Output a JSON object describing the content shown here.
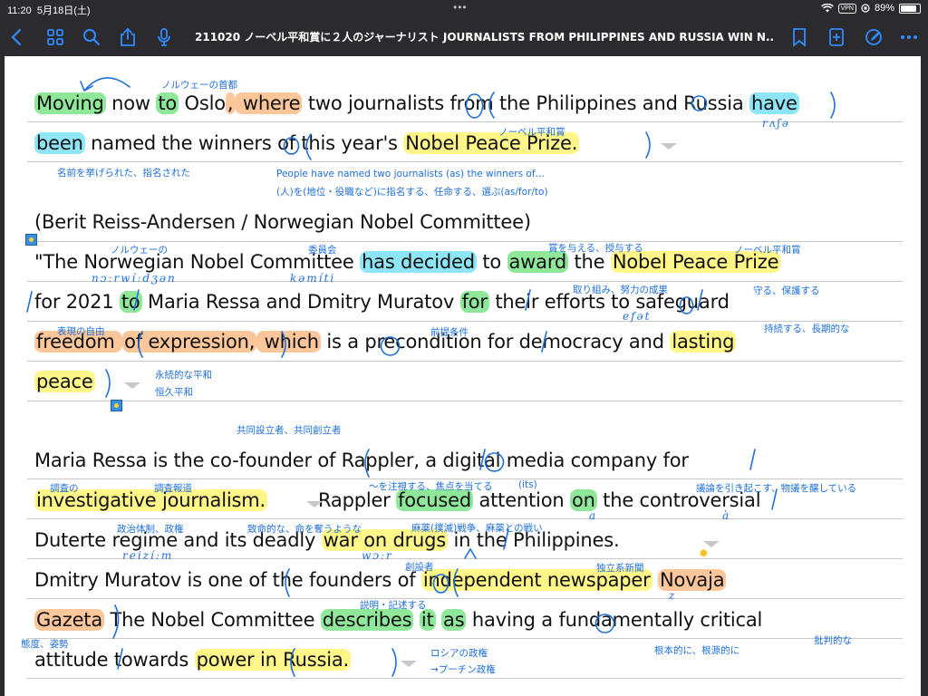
{
  "status": {
    "time": "11:20",
    "date": "5月18日(土)",
    "vpn": "VPN",
    "battery": "89%",
    "battery_level": 0.89
  },
  "toolbar": {
    "title": "211020 ノーベル平和賞に２人のジャーナリスト JOURNALISTS FROM PHILIPPINES AND RUSSIA WIN N...",
    "dropdown": "⌄"
  },
  "text": {
    "l1": {
      "a": "Moving",
      "b": " now ",
      "c": "to",
      "d": " Oslo",
      ",": ",",
      "e": " where",
      "f": " two journalist",
      "g": "s",
      "h": " from the Philippine",
      "i": "s",
      "j": " and Russia ",
      "k": "have"
    },
    "l2": {
      "a": "been",
      "b": " named the winner",
      "c": "s",
      "d": " of this year's ",
      "e": "Nobel Peace Prize."
    },
    "l3": "(Berit Reiss-Andersen / Norwegian Nobel Committee)",
    "l4": {
      "a": "\"The Norwegian Nobel Committee ",
      "b": "has decided",
      "c": " to ",
      "d": "award",
      "e": " the ",
      "f": "Nobel Peace Prize"
    },
    "l5": {
      "a": "for 2021 ",
      "b": "to",
      "c": " Maria Ressa and Dmitry Muratov ",
      "d": "for",
      "e": " their effort",
      "f": "s",
      "g": " to safeguard"
    },
    "l6": {
      "a": "freedom ",
      "b": "of expression,",
      "c": " which",
      "d": " is ",
      "e": "a",
      "f": " precondition for democracy and ",
      "g": "lasting"
    },
    "l7": {
      "a": "peace",
      ".": ".\""
    },
    "l8": {
      "a": "Maria Ressa is the co-founder of Rappler, ",
      "b": "a",
      "c": " digital media company for"
    },
    "l9": {
      "a": "investigative journalism.",
      "b": "Rappler ",
      "c": "focused",
      "d": " attention ",
      "e": "on",
      "f": " the controversial"
    },
    "l10": {
      "a": "Duterte regime and its deadly ",
      "b": "war on drugs",
      "c": " in the Philippines."
    },
    "l11": {
      "a": "Dmitry Muratov is one of the founder",
      "b": "s",
      "c": " of ",
      "d": "independent newspaper",
      "e": " ",
      "f": "Novaja"
    },
    "l12": {
      "a": "Gazeta",
      ".": ".",
      "b": " The Nobel Committee ",
      "c": "describes",
      "d": " ",
      "e": "it",
      "f": " ",
      "g": "as",
      "h": " having ",
      "i": "a",
      "j": " fundamentally critical"
    },
    "l13": {
      "a": "attitude towards ",
      "b": "power in Russia."
    }
  },
  "notes": {
    "n1": "ノルウェーの首都",
    "n2": "ノーベル平和賞",
    "n3": "名前を挙げられた、指名された",
    "n4": "People have named two journalists (as) the winners of…",
    "n5": "(人)を(地位・役職など)に指名する、任命する、選ぶ(as/for/to)",
    "n6": "ノルウェーの",
    "n7": "委員会",
    "n8": "賞を与える、授与する",
    "n9": "ノーベル平和賞",
    "n10": "取り組み、努力の成果",
    "n11": "守る、保護する",
    "n12": "表現の自由",
    "n13": "前提条件",
    "n14": "持続する、長期的な",
    "n15": "永続的な平和",
    "n16": "恒久平和",
    "n17": "共同設立者、共同創立者",
    "n18": "調査の",
    "n19": "調査報道",
    "n20": "〜を注視する、焦点を当てる",
    "n21": "(its)",
    "n22": "議論を引き起こす、物議を醸している",
    "n23": "政治体制、政権",
    "n24": "致命的な、命を奪うような",
    "n25": "麻薬(撲滅)戦争、麻薬との戦い",
    "n26": "創設者",
    "n27": "独立系新聞",
    "n28": "説明・記述する",
    "n29": "態度、姿勢",
    "n30": "ロシアの政権",
    "n31": "→プーチン政権",
    "n32": "根本的に、根源的に",
    "n33": "批判的な"
  },
  "handwriting": {
    "h1": "rʌʃə",
    "h2": "nɔːrwíːdʒən",
    "h3": "kəmíti",
    "h4": "efət",
    "h5": "a",
    "h6": "à",
    "h7": "reizíːm",
    "h8": "wɔːr",
    "h9": "z"
  },
  "colors": {
    "yellow": "#fff68a",
    "green": "#8fe89a",
    "cyan": "#8ee5f6",
    "orange": "#fbc79a",
    "ink": "#1e6fd8",
    "accent": "#2f8cff"
  }
}
